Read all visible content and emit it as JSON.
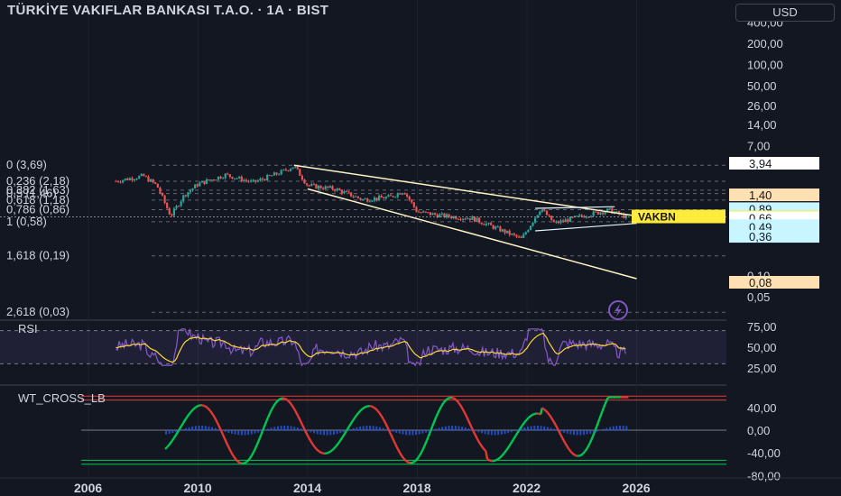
{
  "header": {
    "title": "TÜRKİYE VAKIFLAR BANKASI T.A.O. · 1A · BIST",
    "currency": "USD"
  },
  "price_axis": {
    "ticks": [
      "400,00",
      "200,00",
      "100,00",
      "50,00",
      "26,00",
      "14,00",
      "7,00",
      "3,94",
      "1,40",
      "0,89",
      "0,68",
      "0,66",
      "0,51",
      "0,49",
      "0,36",
      "0,10",
      "0,08",
      "0,05"
    ],
    "ticks_plain": [
      400,
      200,
      100,
      50,
      26,
      14,
      7,
      0.1,
      0.05
    ],
    "badges": [
      {
        "label": "3,94",
        "value": 3.94,
        "style": "white"
      },
      {
        "label": "1,40",
        "value": 1.4,
        "style": "peach"
      },
      {
        "label": "0,89",
        "value": 0.89,
        "style": "cyan"
      },
      {
        "label": "0,68",
        "value": 0.68,
        "style": "yellow"
      },
      {
        "label": "0,66",
        "value": 0.66,
        "style": "white"
      },
      {
        "label": "0,51",
        "value": 0.51,
        "style": "cyan"
      },
      {
        "label": "0,49",
        "value": 0.49,
        "style": "cyan"
      },
      {
        "label": "0,36",
        "value": 0.36,
        "style": "cyan"
      },
      {
        "label": "0,08",
        "value": 0.08,
        "style": "peach"
      }
    ],
    "scale": "log"
  },
  "symbol_label": "VAKBN",
  "fib_levels": [
    {
      "label": "0 (3,69)",
      "value": 3.69
    },
    {
      "label": "0,236 (2,18)",
      "value": 2.18
    },
    {
      "label": "0,382 (1,63)",
      "value": 1.63
    },
    {
      "label": "0,5 (1,46)",
      "value": 1.46
    },
    {
      "label": "0,618 (1,18)",
      "value": 1.18
    },
    {
      "label": "0,786 (0,86)",
      "value": 0.86
    },
    {
      "label": "1 (0,58)",
      "value": 0.58
    },
    {
      "label": "1,618 (0,19)",
      "value": 0.19
    },
    {
      "label": "2,618 (0,03)",
      "value": 0.03
    }
  ],
  "x_axis": {
    "ticks": [
      "2006",
      "2010",
      "2014",
      "2018",
      "2022",
      "2026"
    ],
    "tick_years": [
      2006,
      2010,
      2014,
      2018,
      2022,
      2026
    ]
  },
  "rsi": {
    "label": "RSI",
    "ticks": [
      "75,00",
      "50,00",
      "25,00"
    ],
    "tick_values": [
      75,
      50,
      25
    ]
  },
  "wt": {
    "label": "WT_CROSS_LB",
    "ticks": [
      "40,00",
      "0,00",
      "-40,00",
      "-80,00"
    ],
    "tick_values": [
      40,
      0,
      -40,
      -80
    ]
  },
  "colors": {
    "background": "#131722",
    "up": "#26a69a",
    "down": "#ef5350",
    "trendline": "#fff3c4",
    "rsi_line": "#7e57c2",
    "rsi_ma": "#fdd835",
    "wt_green": "#00c853",
    "wt_red": "#e53935",
    "symbol": "#ffeb3b"
  },
  "chart_data": {
    "type": "candlestick",
    "scale": "log",
    "x_range": [
      2006,
      2027
    ],
    "y_range": [
      0.05,
      400
    ],
    "annual_closes": [
      {
        "x": 2007.0,
        "y": 2.2
      },
      {
        "x": 2008.0,
        "y": 2.6
      },
      {
        "x": 2008.5,
        "y": 1.9
      },
      {
        "x": 2009.0,
        "y": 0.7
      },
      {
        "x": 2009.5,
        "y": 1.4
      },
      {
        "x": 2010.0,
        "y": 2.0
      },
      {
        "x": 2011.0,
        "y": 2.7
      },
      {
        "x": 2012.0,
        "y": 2.1
      },
      {
        "x": 2013.0,
        "y": 2.9
      },
      {
        "x": 2013.5,
        "y": 3.6
      },
      {
        "x": 2014.0,
        "y": 1.9
      },
      {
        "x": 2015.0,
        "y": 1.7
      },
      {
        "x": 2016.0,
        "y": 1.2
      },
      {
        "x": 2017.0,
        "y": 1.3
      },
      {
        "x": 2017.5,
        "y": 1.6
      },
      {
        "x": 2018.0,
        "y": 0.8
      },
      {
        "x": 2019.0,
        "y": 0.7
      },
      {
        "x": 2020.0,
        "y": 0.65
      },
      {
        "x": 2021.0,
        "y": 0.45
      },
      {
        "x": 2021.8,
        "y": 0.33
      },
      {
        "x": 2022.5,
        "y": 0.9
      },
      {
        "x": 2023.0,
        "y": 0.55
      },
      {
        "x": 2024.0,
        "y": 0.7
      },
      {
        "x": 2025.0,
        "y": 0.85
      },
      {
        "x": 2025.6,
        "y": 0.68
      }
    ],
    "last_price": 0.68
  }
}
